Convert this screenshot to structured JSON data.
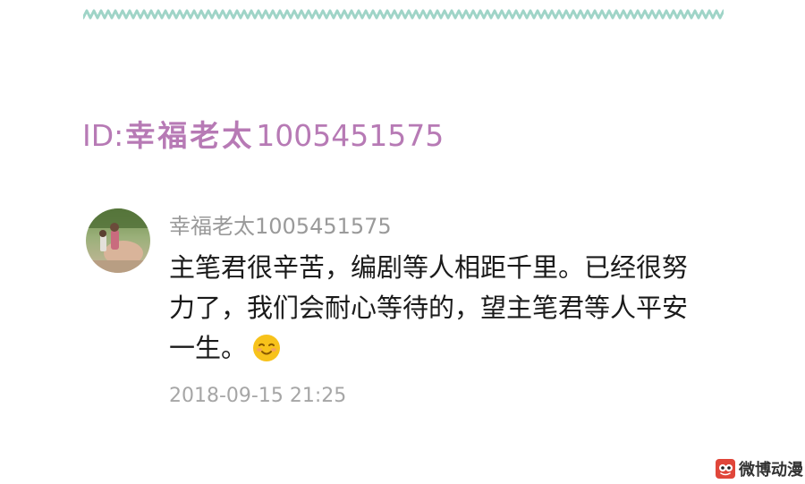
{
  "header": {
    "id_prefix": "ID:",
    "id_name": "幸福老太",
    "id_number": "1005451575"
  },
  "comment": {
    "username": "幸福老太1005451575",
    "text_lines": [
      "主笔君很辛苦，编剧等人相距千里。已经很努",
      "力了，我们会耐心等待的，望主笔君等人平安",
      "一生。"
    ],
    "emoji": "smiling-face-icon",
    "timestamp": "2018-09-15 21:25"
  },
  "watermark": {
    "text": "微博动漫",
    "icon": "weibo-comic-logo-icon"
  },
  "colors": {
    "wave": "#9fd4c7",
    "id_text": "#b77ab5",
    "username": "#9a9a9a",
    "timestamp": "#a6a6a6",
    "comment_text": "#1a1a1a",
    "emoji_face": "#f7c21b"
  }
}
